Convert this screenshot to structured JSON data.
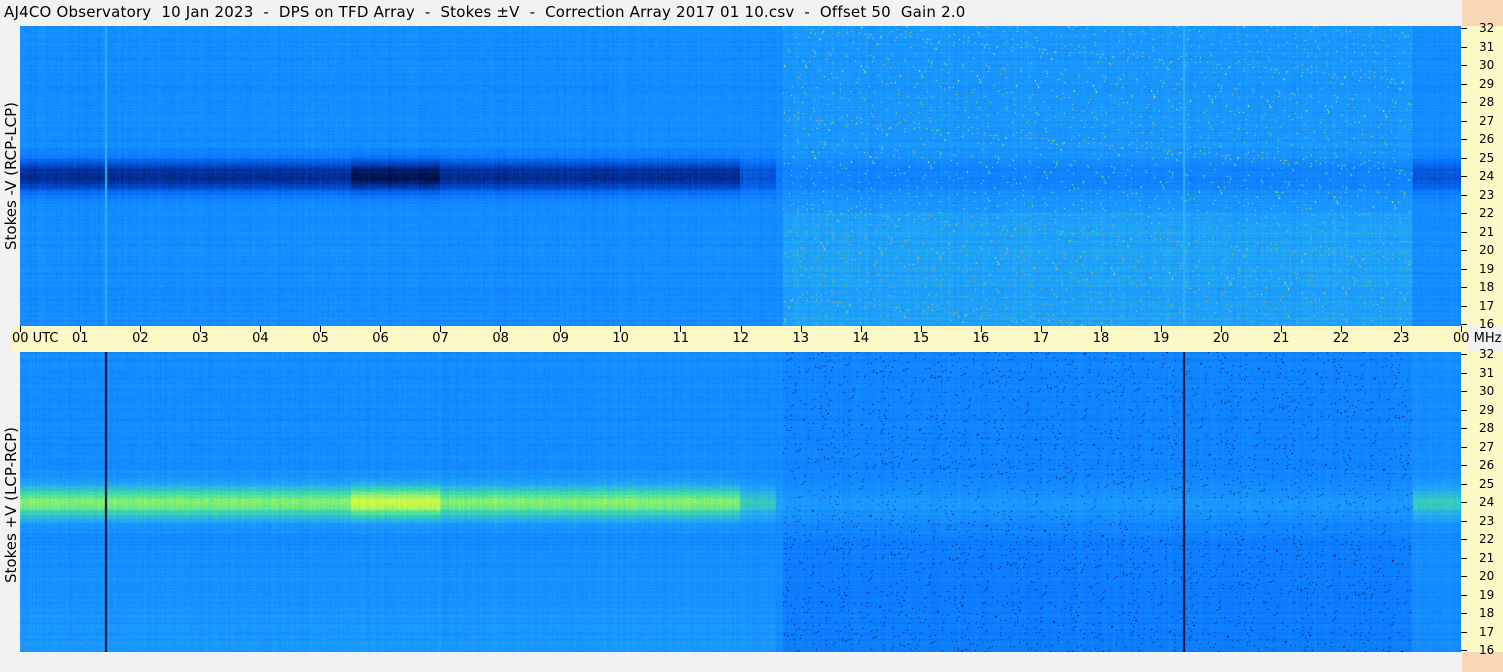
{
  "title": "AJ4CO Observatory  10 Jan 2023  -  DPS on TFD Array  -  Stokes ±V  -  Correction Array 2017 01 10.csv  -  Offset 50  Gain 2.0",
  "chart_data": [
    {
      "type": "heatmap",
      "panel": "top",
      "ylabel": "Stokes -V (RCP-LCP)",
      "x_ticks": [
        "00 UTC",
        "01",
        "02",
        "03",
        "04",
        "05",
        "06",
        "07",
        "08",
        "09",
        "10",
        "11",
        "12",
        "13",
        "14",
        "15",
        "16",
        "17",
        "18",
        "19",
        "20",
        "21",
        "22",
        "23",
        "00"
      ],
      "x_range_hours": [
        0,
        24
      ],
      "y_unit": "MHz",
      "y_range": [
        16,
        32
      ],
      "y_ticks": [
        "16",
        "17",
        "18",
        "19",
        "20",
        "21",
        "22",
        "23",
        "24",
        "25",
        "26",
        "27",
        "28",
        "29",
        "30",
        "31",
        "32"
      ],
      "colormap": [
        "#000a3c",
        "#0040c0",
        "#0a78ff",
        "#1ea0ff",
        "#40e0a0",
        "#d8ff40",
        "#ff6040"
      ],
      "dominant_band_mhz": 24,
      "band_sign": "negative"
    },
    {
      "type": "heatmap",
      "panel": "bottom",
      "ylabel": "Stokes +V (LCP-RCP)",
      "x_ticks": [
        "00 UTC",
        "01",
        "02",
        "03",
        "04",
        "05",
        "06",
        "07",
        "08",
        "09",
        "10",
        "11",
        "12",
        "13",
        "14",
        "15",
        "16",
        "17",
        "18",
        "19",
        "20",
        "21",
        "22",
        "23",
        "00"
      ],
      "x_range_hours": [
        0,
        24
      ],
      "y_unit": "MHz",
      "y_range": [
        16,
        32
      ],
      "y_ticks": [
        "16",
        "17",
        "18",
        "19",
        "20",
        "21",
        "22",
        "23",
        "24",
        "25",
        "26",
        "27",
        "28",
        "29",
        "30",
        "31",
        "32"
      ],
      "colormap": [
        "#000a3c",
        "#0040c0",
        "#0a78ff",
        "#1ea0ff",
        "#40e0a0",
        "#d8ff40",
        "#ff6040"
      ],
      "dominant_band_mhz": 24,
      "band_sign": "positive"
    }
  ],
  "time_axis": {
    "labels": [
      "00 UTC",
      "01",
      "02",
      "03",
      "04",
      "05",
      "06",
      "07",
      "08",
      "09",
      "10",
      "11",
      "12",
      "13",
      "14",
      "15",
      "16",
      "17",
      "18",
      "19",
      "20",
      "21",
      "22",
      "23",
      "00 MHz"
    ]
  },
  "freq_axis": {
    "labels": [
      "32",
      "31",
      "30",
      "29",
      "28",
      "27",
      "26",
      "25",
      "24",
      "23",
      "22",
      "21",
      "20",
      "19",
      "18",
      "17",
      "16"
    ]
  }
}
